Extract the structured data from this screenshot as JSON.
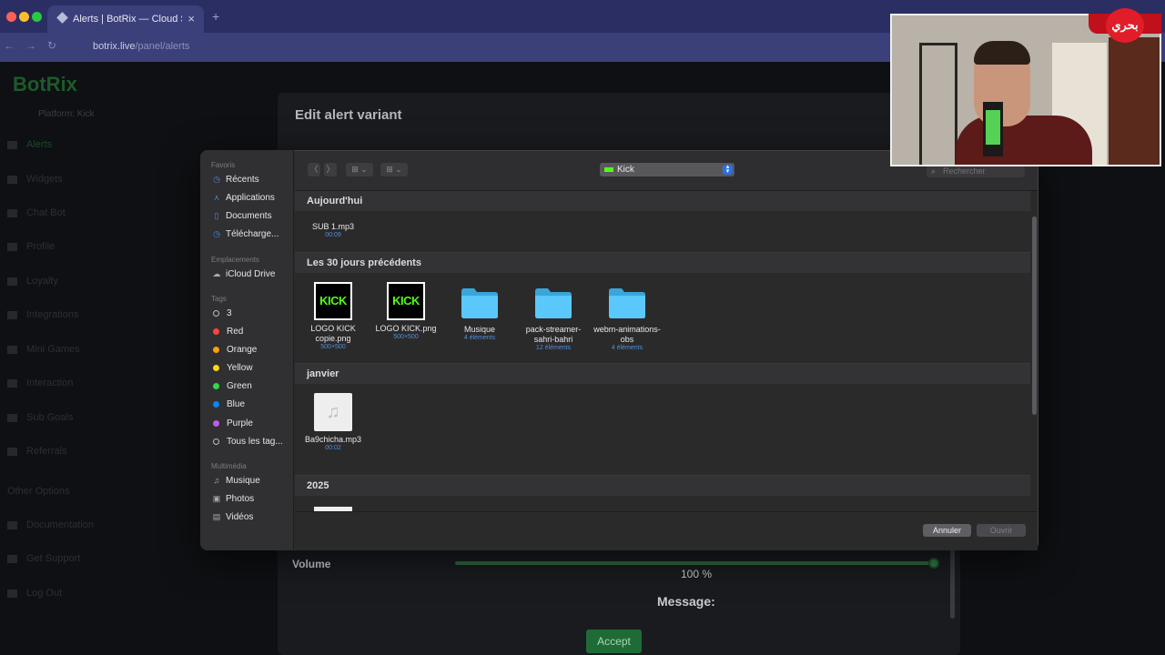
{
  "browser": {
    "tab_title": "Alerts | BotRix — Cloud Strea",
    "tab_close": "×",
    "new_tab": "+",
    "url_domain": "botrix.live",
    "url_path": "/panel/alerts",
    "nav": [
      "←",
      "→",
      "↻"
    ]
  },
  "app": {
    "logo": "BotRix",
    "platform": "Platform: Kick",
    "sidebar": [
      "Alerts",
      "Widgets",
      "Chat Bot",
      "Profile",
      "Loyalty",
      "Integrations",
      "Mini Games",
      "Interaction",
      "Sub Goals",
      "Referrals",
      "Other Options",
      "Documentation",
      "Get Support",
      "Log Out"
    ],
    "modal_title": "Edit alert variant",
    "volume_label": "Volume",
    "volume_value": "100 %",
    "volume_level": 1.0,
    "message_label": "Message:",
    "accept_label": "Accept"
  },
  "dialog": {
    "sidebar": {
      "favorites_header": "Favoris",
      "favorites": [
        {
          "label": "Récents",
          "icon": "clock-icon"
        },
        {
          "label": "Applications",
          "icon": "apps-icon"
        },
        {
          "label": "Documents",
          "icon": "document-icon"
        },
        {
          "label": "Télécharge...",
          "icon": "download-icon"
        }
      ],
      "locations_header": "Emplacements",
      "locations": [
        {
          "label": "iCloud Drive",
          "icon": "cloud-icon"
        }
      ],
      "tags_header": "Tags",
      "tags": [
        {
          "label": "3",
          "color": "none"
        },
        {
          "label": "Red",
          "color": "#ff453a"
        },
        {
          "label": "Orange",
          "color": "#ff9f0a"
        },
        {
          "label": "Yellow",
          "color": "#ffd60a"
        },
        {
          "label": "Green",
          "color": "#32d74b"
        },
        {
          "label": "Blue",
          "color": "#0a84ff"
        },
        {
          "label": "Purple",
          "color": "#bf5af2"
        },
        {
          "label": "Tous les tag...",
          "color": "none"
        }
      ],
      "media_header": "Multimédia",
      "media": [
        {
          "label": "Musique",
          "icon": "music-icon"
        },
        {
          "label": "Photos",
          "icon": "camera-icon"
        },
        {
          "label": "Vidéos",
          "icon": "film-icon"
        }
      ]
    },
    "toolbar": {
      "back": "〈",
      "forward": "〉",
      "view_icons": "⊞ ⌄",
      "group_icons": "⊞ ⌄",
      "location": "Kick",
      "search_placeholder": "Rechercher"
    },
    "groups": [
      {
        "title": "Aujourd'hui",
        "files": [
          {
            "name": "SUB 1.mp3",
            "meta": "00:09",
            "kind": "audio"
          }
        ]
      },
      {
        "title": "Les 30 jours précédents",
        "files": [
          {
            "name": "LOGO KICK copie.png",
            "meta": "500×500",
            "kind": "kick",
            "thumb": "KICK"
          },
          {
            "name": "LOGO KICK.png",
            "meta": "500×500",
            "kind": "kick",
            "thumb": "KICK"
          },
          {
            "name": "Musique",
            "meta": "4 éléments",
            "kind": "folder"
          },
          {
            "name": "pack-streamer-sahri-bahri",
            "meta": "12 éléments",
            "kind": "folder"
          },
          {
            "name": "webm-animations-obs",
            "meta": "4 éléments",
            "kind": "folder"
          }
        ]
      },
      {
        "title": "janvier",
        "files": [
          {
            "name": "Ba9chicha.mp3",
            "meta": "00:02",
            "kind": "audio"
          }
        ]
      },
      {
        "title": "2025",
        "files": []
      }
    ],
    "cancel_label": "Annuler",
    "open_label": "Ouvrir"
  },
  "overlay": {
    "channel_logo": "بحري"
  },
  "colors": {
    "kick_green": "#53fc18",
    "folder_blue": "#5ac8fa",
    "accent_blue": "#2d6fe0"
  }
}
